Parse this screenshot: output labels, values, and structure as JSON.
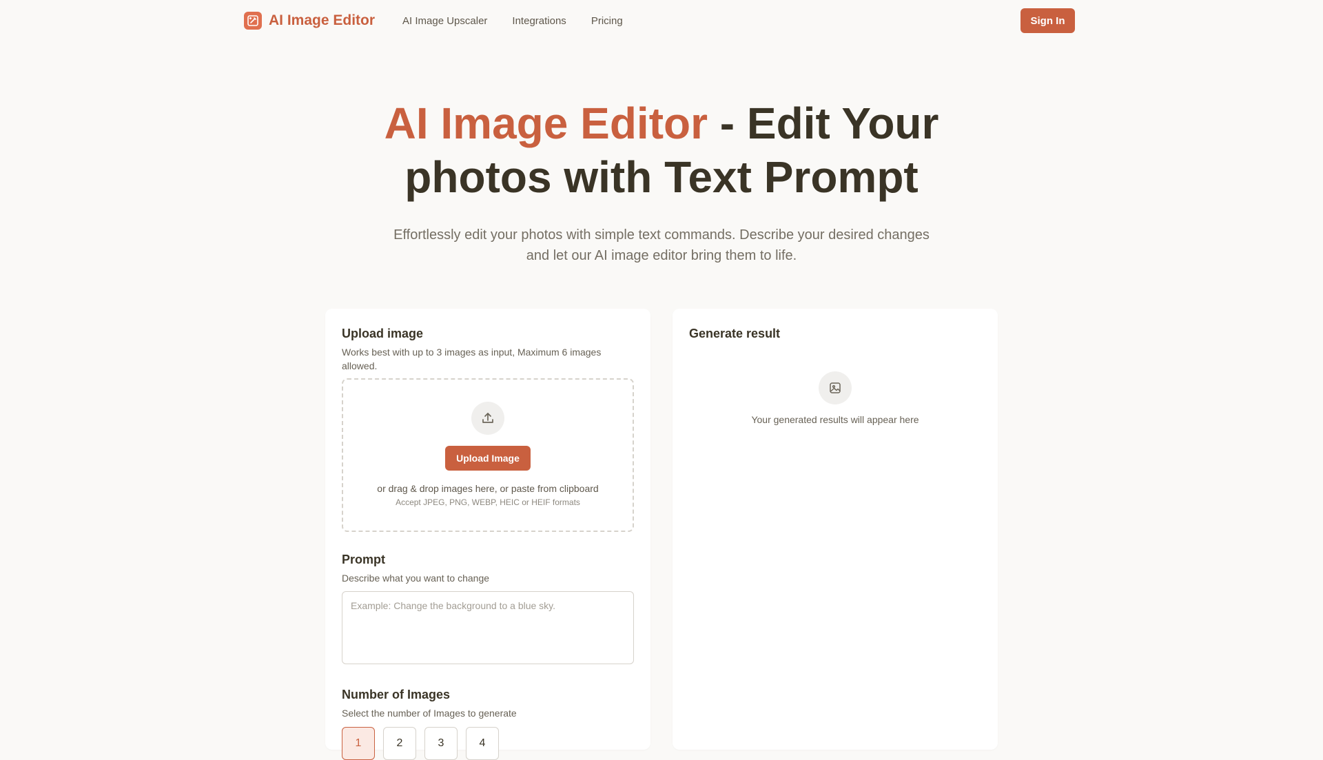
{
  "nav": {
    "brand_name": "AI Image Editor",
    "links": [
      "AI Image Upscaler",
      "Integrations",
      "Pricing"
    ],
    "signin_label": "Sign In"
  },
  "hero": {
    "title_accent": "AI Image Editor",
    "title_rest": " - Edit Your photos with Text Prompt",
    "subtitle": "Effortlessly edit your photos with simple text commands. Describe your desired changes and let our AI image editor bring them to life."
  },
  "upload": {
    "title": "Upload image",
    "description": "Works best with up to 3 images as input, Maximum 6 images allowed.",
    "icon": "upload-icon",
    "button_label": "Upload Image",
    "drop_text": "or drag & drop images here, or paste from clipboard",
    "formats_text": "Accept JPEG, PNG, WEBP, HEIC or HEIF formats"
  },
  "prompt": {
    "title": "Prompt",
    "description": "Describe what you want to change",
    "placeholder": "Example: Change the background to a blue sky.",
    "value": ""
  },
  "count": {
    "title": "Number of Images",
    "description": "Select the number of Images to generate",
    "options": [
      "1",
      "2",
      "3",
      "4"
    ],
    "selected": "1"
  },
  "result": {
    "title": "Generate result",
    "icon": "image-icon",
    "empty_text": "Your generated results will appear here"
  },
  "colors": {
    "accent": "#c9603f",
    "logo": "#e0704f",
    "background": "#faf9f7",
    "text": "#3a3426"
  }
}
